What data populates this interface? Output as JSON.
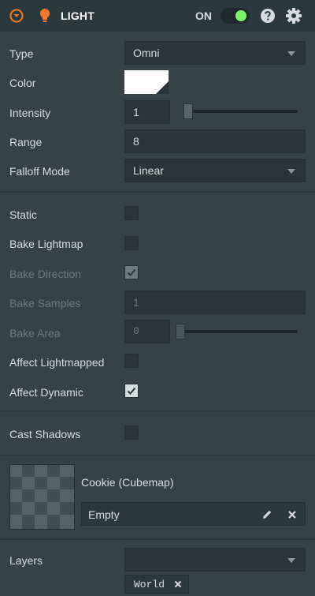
{
  "header": {
    "title": "LIGHT",
    "toggle_label": "ON",
    "enabled": true,
    "icons": [
      "collapse-icon",
      "lightbulb-icon",
      "help-icon",
      "gear-icon"
    ]
  },
  "properties": {
    "type": {
      "label": "Type",
      "value": "Omni"
    },
    "color": {
      "label": "Color",
      "value": "#ffffff"
    },
    "intensity": {
      "label": "Intensity",
      "value": "1",
      "slider_fraction": 0.0
    },
    "range": {
      "label": "Range",
      "value": "8"
    },
    "falloff_mode": {
      "label": "Falloff Mode",
      "value": "Linear"
    }
  },
  "baking": {
    "static": {
      "label": "Static",
      "checked": false
    },
    "bake_lightmap": {
      "label": "Bake Lightmap",
      "checked": false
    },
    "bake_direction": {
      "label": "Bake Direction",
      "checked": true,
      "disabled": true
    },
    "bake_samples": {
      "label": "Bake Samples",
      "value": "1",
      "disabled": true
    },
    "bake_area": {
      "label": "Bake Area",
      "value": "0",
      "slider_fraction": 0.0,
      "disabled": true
    },
    "affect_lightmapped": {
      "label": "Affect Lightmapped",
      "checked": false
    },
    "affect_dynamic": {
      "label": "Affect Dynamic",
      "checked": true
    }
  },
  "shadows": {
    "cast_shadows": {
      "label": "Cast Shadows",
      "checked": false
    }
  },
  "cookie": {
    "title": "Cookie (Cubemap)",
    "value": "Empty"
  },
  "layers": {
    "label": "Layers",
    "dropdown_value": "",
    "tags": [
      "World"
    ]
  },
  "colors": {
    "panel_bg": "#364346",
    "header_bg": "#2c393c",
    "field_bg": "#2a3538",
    "toggle_on": "#7cf26b",
    "accent_orange": "#f47a2a"
  }
}
